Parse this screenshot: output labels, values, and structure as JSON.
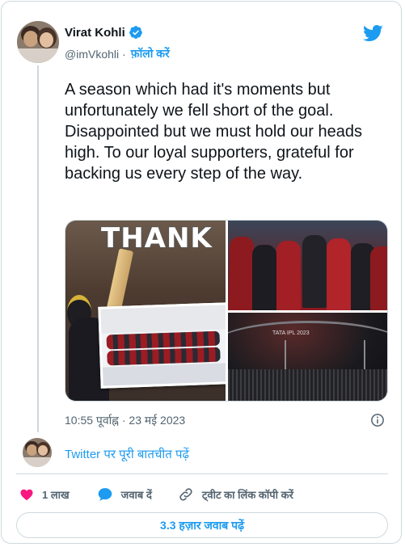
{
  "author": {
    "name": "Virat Kohli",
    "handle": "@imVkohli",
    "separator": "·",
    "follow_label": "फ़ॉलो करें",
    "verified": true
  },
  "tweet": {
    "text": "A season which had it's moments but unfortunately we fell short of the goal. Disappointed but we must hold our heads high. To our loyal supporters, grateful for backing us every step of the way.",
    "media_texts": {
      "thank_caption": "THANK",
      "ipl_tag": "TATA IPL 2023"
    },
    "timestamp": "10:55 पूर्वाह्न · 23 मई 2023"
  },
  "conversation": {
    "read_label": "Twitter पर पूरी बातचीत पढ़ें"
  },
  "actions": {
    "likes_count": "1 लाख",
    "reply_label": "जवाब दें",
    "copy_link_label": "ट्वीट का लिंक कॉपी करें"
  },
  "replies_button": {
    "label": "3.3 हज़ार जवाब पढ़ें"
  },
  "colors": {
    "accent": "#1d9bf0",
    "like": "#f91880",
    "text_primary": "#0f1419",
    "text_secondary": "#536471",
    "border": "#cfd9de"
  },
  "icons": [
    "verified-badge-icon",
    "twitter-bird-icon",
    "info-icon",
    "heart-icon",
    "reply-bubble-icon",
    "link-icon"
  ]
}
